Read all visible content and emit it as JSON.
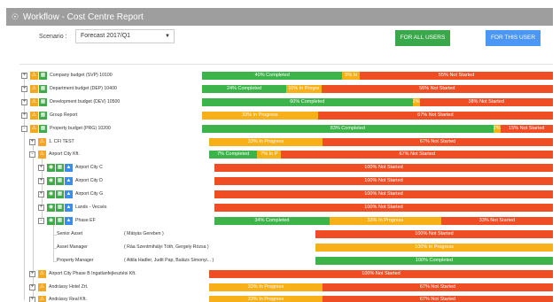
{
  "window": {
    "title": "Workflow - Cost Centre Report"
  },
  "filters": {
    "scenario_label": "Scenario :",
    "scenario_value": "Forecast 2017/Q1"
  },
  "buttons": {
    "all_users": "FOR ALL USERS",
    "this_user": "FOR THIS USER"
  },
  "colors": {
    "completed": "#3cb449",
    "in_progress": "#f7b018",
    "not_started": "#ef4e25"
  },
  "rows": [
    {
      "label": "Company budget (SVP) 10100",
      "expander": "+",
      "icons": [
        "warning-icon",
        "grid-icon"
      ],
      "segments": [
        {
          "status": "green",
          "value": 40,
          "text": "40% Completed"
        },
        {
          "status": "yellow",
          "value": 5,
          "text": "5% In"
        },
        {
          "status": "red",
          "value": 55,
          "text": "55% Not Started"
        }
      ]
    },
    {
      "label": "Department budget (DEP) 10400",
      "expander": "+",
      "icons": [
        "warning-icon",
        "grid-icon"
      ],
      "segments": [
        {
          "status": "green",
          "value": 24,
          "text": "24% Completed"
        },
        {
          "status": "yellow",
          "value": 10,
          "text": "10% In Progre"
        },
        {
          "status": "red",
          "value": 66,
          "text": "56% Not Started"
        }
      ]
    },
    {
      "label": "Development budget (DEV) 10500",
      "expander": "+",
      "icons": [
        "warning-icon",
        "grid-icon"
      ],
      "segments": [
        {
          "status": "green",
          "value": 60,
          "text": "60% Completed"
        },
        {
          "status": "yellow",
          "value": 2,
          "text": "2%"
        },
        {
          "status": "red",
          "value": 38,
          "text": "38% Not Started"
        }
      ]
    },
    {
      "label": "Group Report",
      "expander": "+",
      "icons": [
        "warning-icon",
        "grid-icon"
      ],
      "segments": [
        {
          "status": "yellow",
          "value": 33,
          "text": "33% In Progress"
        },
        {
          "status": "red",
          "value": 67,
          "text": "67% Not Started"
        }
      ]
    },
    {
      "label": "Property budget (PRG) 10200",
      "expander": "-",
      "icons": [
        "warning-icon",
        "grid-icon"
      ],
      "segments": [
        {
          "status": "green",
          "value": 83,
          "text": "83% Completed"
        },
        {
          "status": "yellow",
          "value": 2,
          "text": "2%"
        },
        {
          "status": "red",
          "value": 15,
          "text": "15% Not Started"
        }
      ]
    },
    {
      "label": "1. CFI TEST",
      "expander": "+",
      "icons": [
        "warning-icon"
      ],
      "segments": [
        {
          "status": "yellow",
          "value": 33,
          "text": "33% In Progress"
        },
        {
          "status": "red",
          "value": 67,
          "text": "67% Not Started"
        }
      ]
    },
    {
      "label": "Airport City Kft.",
      "expander": "-",
      "icons": [
        "warning-icon"
      ],
      "segments": [
        {
          "status": "green",
          "value": 14,
          "text": "7% Completed"
        },
        {
          "status": "yellow",
          "value": 7,
          "text": "7% In P"
        },
        {
          "status": "red",
          "value": 79,
          "text": "67% Not Started"
        }
      ]
    },
    {
      "label": "Airport City C",
      "expander": "+",
      "icons": [
        "eye-icon",
        "grid-icon",
        "user-icon"
      ],
      "segments": [
        {
          "status": "red",
          "value": 100,
          "text": "100% Not Started"
        }
      ]
    },
    {
      "label": "Airport City D",
      "expander": "+",
      "icons": [
        "eye-icon",
        "grid-icon",
        "user-icon"
      ],
      "segments": [
        {
          "status": "red",
          "value": 100,
          "text": "100% Not Started"
        }
      ]
    },
    {
      "label": "Airport City G",
      "expander": "+",
      "icons": [
        "eye-icon",
        "grid-icon",
        "user-icon"
      ],
      "segments": [
        {
          "status": "red",
          "value": 100,
          "text": "100% Not Started"
        }
      ]
    },
    {
      "label": "Lands - Vecsés",
      "expander": "+",
      "icons": [
        "eye-icon",
        "grid-icon",
        "user-icon"
      ],
      "segments": [
        {
          "status": "red",
          "value": 100,
          "text": "100% Not Started"
        }
      ]
    },
    {
      "label": "Phase EF",
      "expander": "-",
      "icons": [
        "eye-icon",
        "grid-icon",
        "user-icon"
      ],
      "segments": [
        {
          "status": "green",
          "value": 34,
          "text": "34% Completed"
        },
        {
          "status": "yellow",
          "value": 33,
          "text": "33% In Progress"
        },
        {
          "status": "red",
          "value": 33,
          "text": "33% Not Started"
        }
      ]
    },
    {
      "role": "Senior Asset",
      "people": "( Mátyás Gereben )",
      "segments": [
        {
          "status": "red",
          "value": 100,
          "text": "100% Not Started"
        }
      ]
    },
    {
      "role": "Asset Manager",
      "people": "( Ráa Szentmihályi Tóth, Gergely Rózsa )",
      "segments": [
        {
          "status": "yellow",
          "value": 100,
          "text": "100% In Progress"
        }
      ]
    },
    {
      "role": "Property Manager",
      "people": "( Attila Hadler, Judit Pap, Balázs Simonyi... )",
      "segments": [
        {
          "status": "green",
          "value": 100,
          "text": "100% Completed"
        }
      ]
    },
    {
      "label": "Airport City Phase B Ingatlanfejlesztési Kft.",
      "expander": "+",
      "icons": [
        "warning-icon"
      ],
      "segments": [
        {
          "status": "red",
          "value": 100,
          "text": "100% Not Started"
        }
      ]
    },
    {
      "label": "Andrássy Hotel Zrt.",
      "expander": "+",
      "icons": [
        "warning-icon"
      ],
      "segments": [
        {
          "status": "yellow",
          "value": 33,
          "text": "33% In Progress"
        },
        {
          "status": "red",
          "value": 67,
          "text": "67% Not Started"
        }
      ]
    },
    {
      "label": "Andrássy Real Kft.",
      "expander": "+",
      "icons": [
        "warning-icon"
      ],
      "segments": [
        {
          "status": "yellow",
          "value": 33,
          "text": "33% In Progress"
        },
        {
          "status": "red",
          "value": 67,
          "text": "67% Not Started"
        }
      ]
    }
  ]
}
